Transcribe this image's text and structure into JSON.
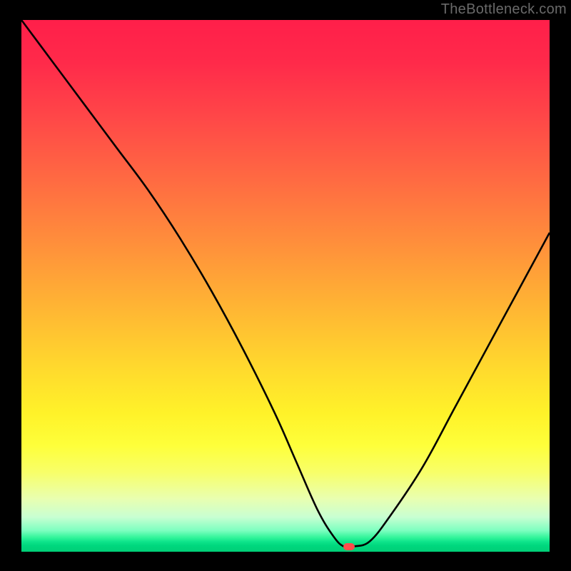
{
  "watermark": "TheBottleneck.com",
  "chart_data": {
    "type": "line",
    "title": "",
    "xlabel": "",
    "ylabel": "",
    "xlim": [
      0,
      100
    ],
    "ylim": [
      0,
      100
    ],
    "grid": false,
    "legend": false,
    "background_gradient": {
      "top": "#ff1f4a",
      "middle": "#ffd92e",
      "bottom": "#00cf77"
    },
    "series": [
      {
        "name": "bottleneck-curve",
        "color": "#000000",
        "x": [
          0,
          6,
          12,
          18,
          24,
          30,
          36,
          42,
          48,
          52,
          56,
          59,
          61,
          63,
          66,
          70,
          76,
          82,
          88,
          94,
          100
        ],
        "y": [
          100,
          92,
          84,
          76,
          68,
          59,
          49,
          38,
          26,
          17,
          8,
          3,
          1,
          1,
          2,
          7,
          16,
          27,
          38,
          49,
          60
        ]
      }
    ],
    "marker": {
      "name": "optimal-point",
      "x": 62,
      "y": 1,
      "color": "#ff4b4b"
    }
  }
}
